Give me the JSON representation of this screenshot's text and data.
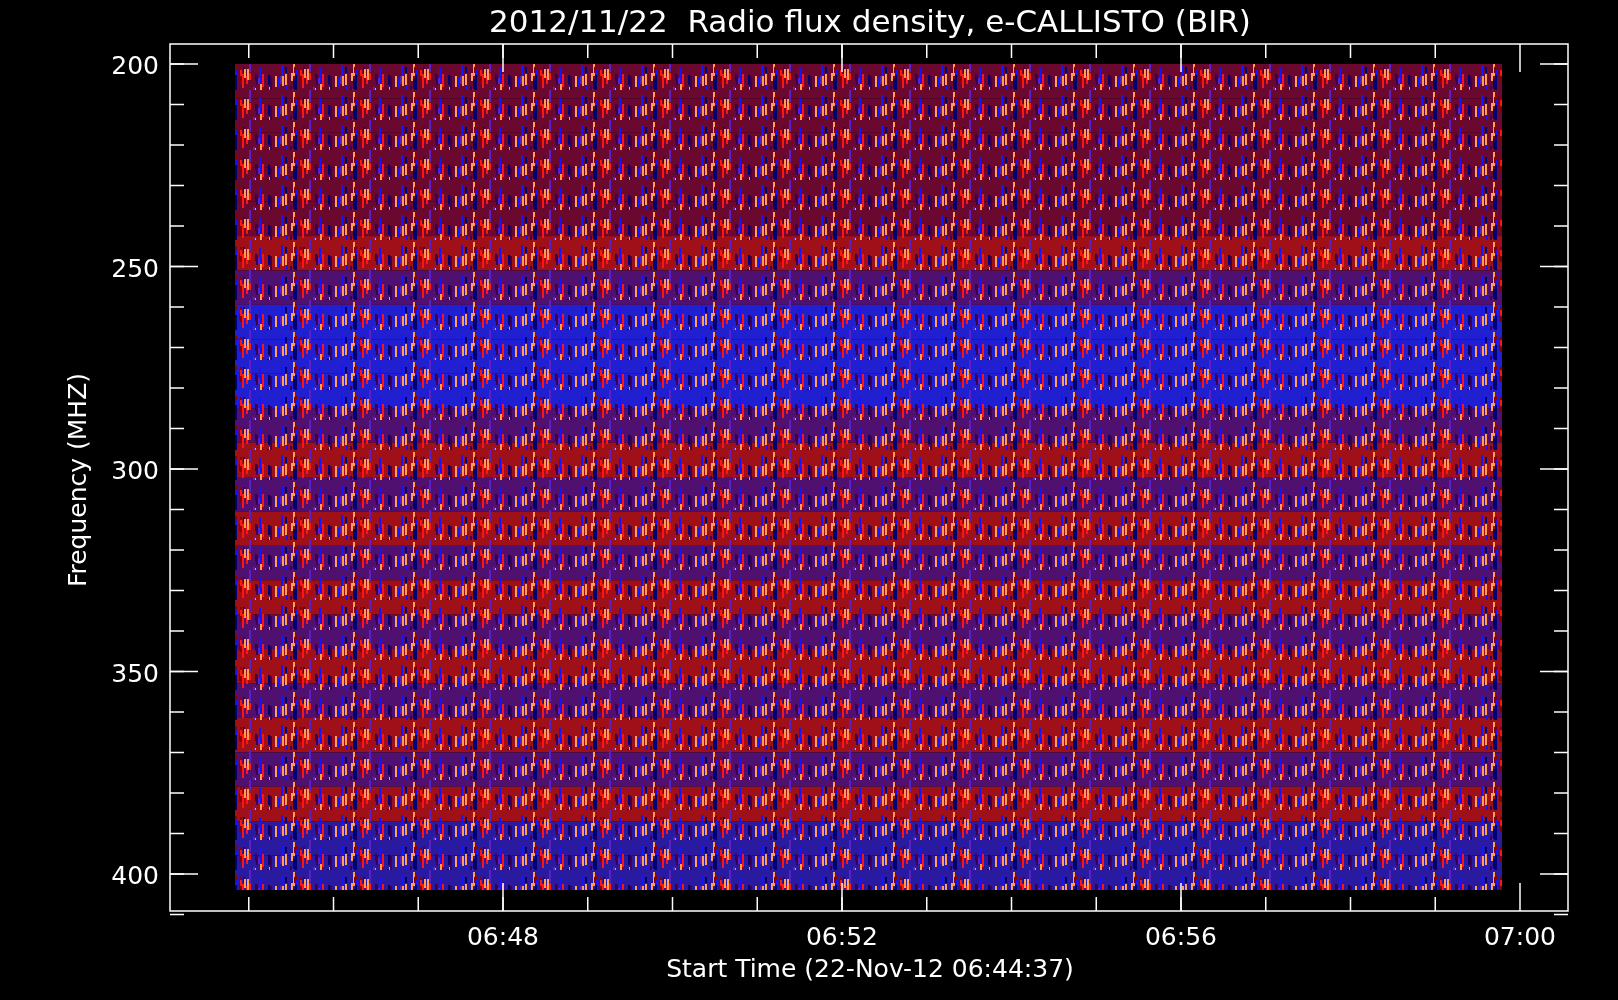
{
  "title": "2012/11/22  Radio flux density, e-CALLISTO (BIR)",
  "ylabel": "Frequency (MHZ)",
  "xlabel": "Start Time (22-Nov-12 06:44:37)",
  "yticks": [
    "200",
    "250",
    "300",
    "350",
    "400"
  ],
  "xticks": [
    "06:48",
    "06:52",
    "06:56",
    "07:00"
  ]
}
